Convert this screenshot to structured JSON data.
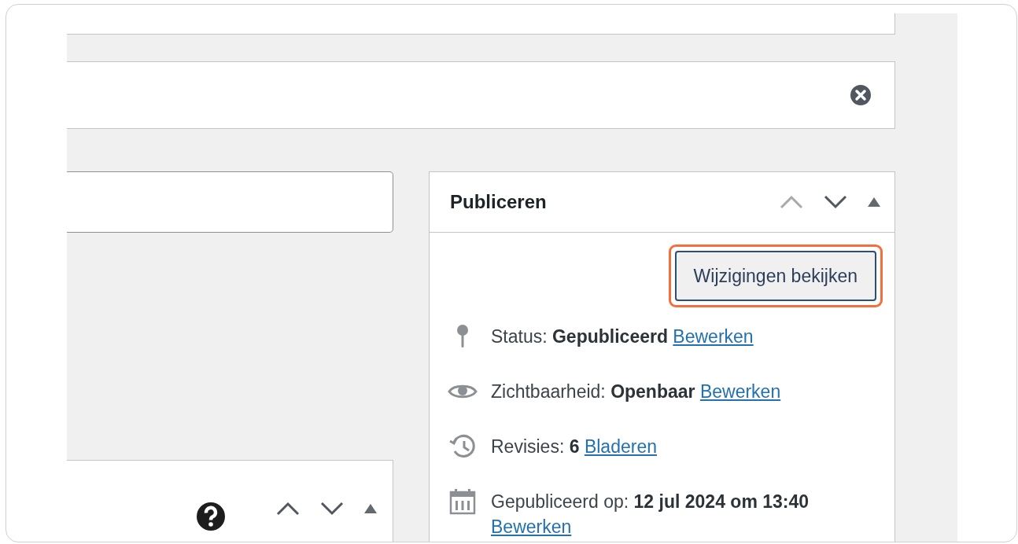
{
  "publish_box": {
    "title": "Publiceren",
    "preview_button": "Wijzigingen bekijken",
    "rows": [
      {
        "kind": "status",
        "text": "Status: **Gepubliceerd**",
        "link": "Bewerken"
      },
      {
        "kind": "visibility",
        "text": "Zichtbaarheid: **Openbaar**",
        "link": "Bewerken"
      },
      {
        "kind": "revisions",
        "text": "Revisies: **6**",
        "link": "Bladeren"
      },
      {
        "kind": "published",
        "text": "Gepubliceerd op: **12 jul 2024 om 13:40**",
        "link": "Bewerken"
      }
    ]
  }
}
